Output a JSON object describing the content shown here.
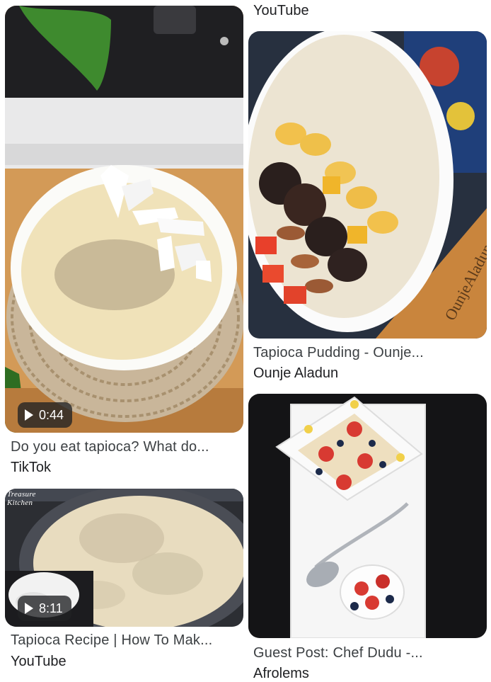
{
  "results": [
    {
      "id": "tiktok",
      "title": "Do you eat tapioca? What do...",
      "source": "TikTok",
      "duration": "0:44",
      "thumbnail": "bowl-of-creamy-tapioca-with-coconut-slices"
    },
    {
      "id": "yt-recipe",
      "title": "Tapioca Recipe | How To Mak...",
      "source": "YouTube",
      "duration": "8:11",
      "watermark": "Treasure Kitchen",
      "thumbnail": "pot-of-tapioca-pudding"
    },
    {
      "id": "yt-pudding-top",
      "source": "YouTube"
    },
    {
      "id": "ounje",
      "title": "Tapioca Pudding - Ounje...",
      "source": "Ounje Aladun",
      "watermark": "OunjeAladun",
      "thumbnail": "tapioca-bowl-with-fruits-and-nuts"
    },
    {
      "id": "afrolems",
      "title": "Guest Post: Chef Dudu -...",
      "source": "Afrolems",
      "thumbnail": "plated-tapioca-with-berries"
    }
  ]
}
